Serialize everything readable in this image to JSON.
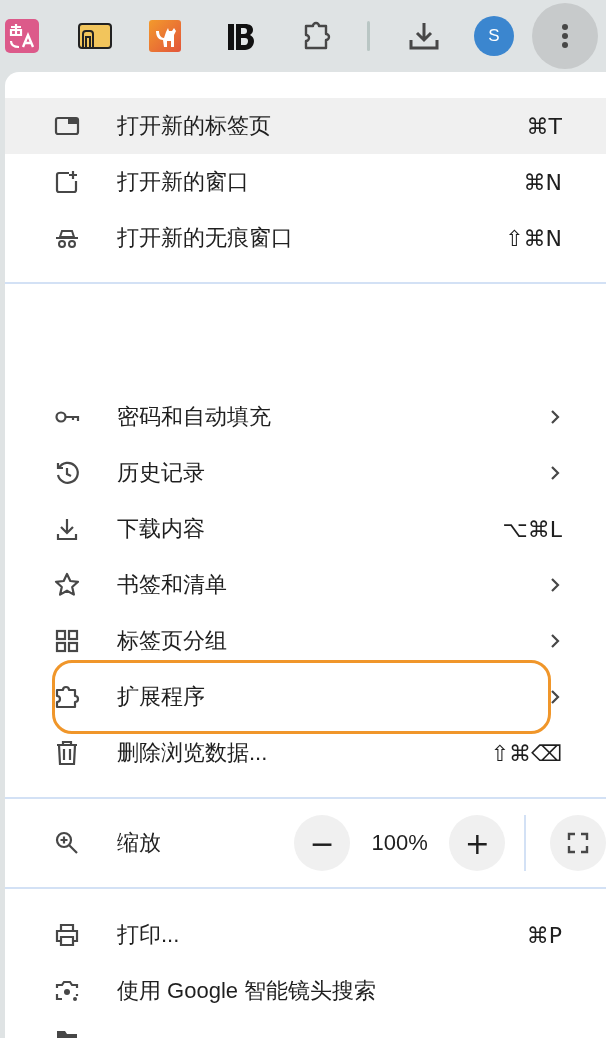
{
  "toolbar": {
    "avatar": "S",
    "menu_open": true
  },
  "menu": {
    "top_items": [
      {
        "label": "打开新的标签页",
        "kind": "shortcut",
        "shortcut": "⌘T",
        "selected": true,
        "highlighted": false
      },
      {
        "label": "打开新的窗口",
        "kind": "shortcut",
        "shortcut": "⌘N",
        "selected": false,
        "highlighted": false
      },
      {
        "label": "打开新的无痕窗口",
        "kind": "shortcut",
        "shortcut": "⇧⌘N",
        "selected": false,
        "highlighted": false
      }
    ],
    "middle_items": [
      {
        "label": "密码和自动填充",
        "kind": "submenu",
        "selected": false,
        "highlighted": false
      },
      {
        "label": "历史记录",
        "kind": "submenu",
        "selected": false,
        "highlighted": false
      },
      {
        "label": "下载内容",
        "kind": "shortcut",
        "shortcut": "⌥⌘L",
        "selected": false,
        "highlighted": false
      },
      {
        "label": "书签和清单",
        "kind": "submenu",
        "selected": false,
        "highlighted": false
      },
      {
        "label": "标签页分组",
        "kind": "submenu",
        "selected": false,
        "highlighted": false
      },
      {
        "label": "扩展程序",
        "kind": "submenu",
        "selected": false,
        "highlighted": true
      },
      {
        "label": "删除浏览数据...",
        "kind": "shortcut",
        "shortcut": "⇧⌘⌫",
        "selected": false,
        "highlighted": false
      }
    ],
    "zoom": {
      "label": "缩放",
      "minus": "−",
      "value": "100%",
      "plus": "+"
    },
    "bottom_items": [
      {
        "label": "打印...",
        "kind": "shortcut",
        "shortcut": "⌘P",
        "selected": false
      },
      {
        "label": "使用 Google 智能镜头搜索",
        "kind": "plain",
        "selected": false
      }
    ]
  }
}
